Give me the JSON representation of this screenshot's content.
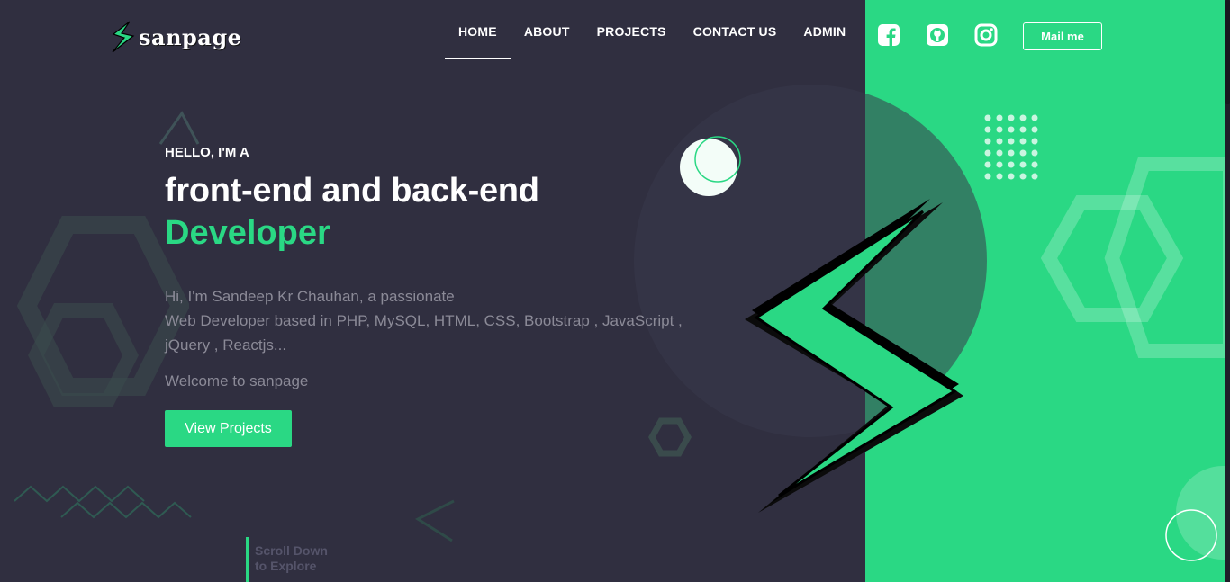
{
  "brand": {
    "name": "sanpage",
    "logo_icon": "lightning-bolt-icon"
  },
  "nav": [
    {
      "label": "HOME",
      "active": true
    },
    {
      "label": "ABOUT",
      "active": false
    },
    {
      "label": "PROJECTS",
      "active": false
    },
    {
      "label": "CONTACT US",
      "active": false
    },
    {
      "label": "ADMIN",
      "active": false
    }
  ],
  "social": [
    {
      "icon": "facebook-icon"
    },
    {
      "icon": "github-icon"
    },
    {
      "icon": "instagram-icon"
    }
  ],
  "mail_button": "Mail me",
  "hero": {
    "eyebrow": "HELLO, I'M A",
    "headline": "front-end and back-end",
    "headline_accent": "Developer",
    "intro_line1": "Hi, I'm Sandeep Kr Chauhan, a passionate",
    "intro_line2": "Web Developer based in PHP, MySQL, HTML, CSS, Bootstrap , JavaScript ,",
    "intro_line3": "jQuery , Reactjs...",
    "welcome": "Welcome to sanpage",
    "cta": "View Projects"
  },
  "scroll_hint": {
    "line1": "Scroll Down",
    "line2": "to Explore"
  },
  "colors": {
    "background": "#302f40",
    "accent": "#2ad884",
    "muted_text": "#8b8a97"
  }
}
